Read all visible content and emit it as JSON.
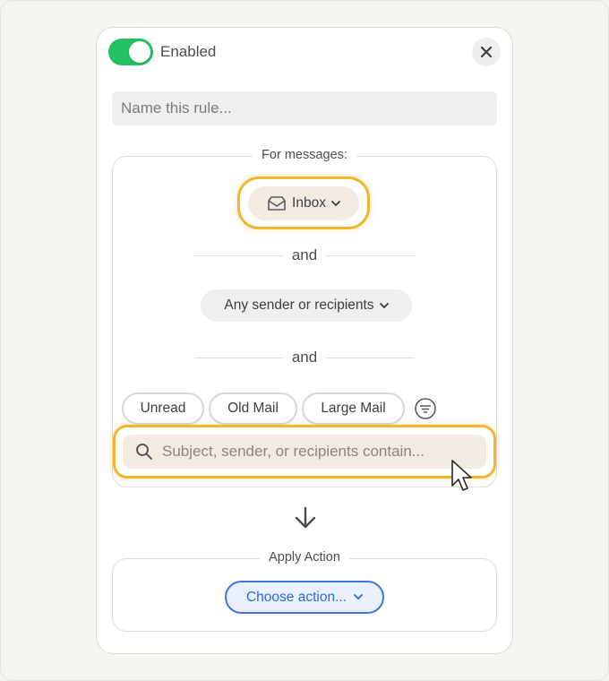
{
  "rule": {
    "enabled_label": "Enabled",
    "enabled": true,
    "name_placeholder": "Name this rule..."
  },
  "conditions": {
    "legend": "For messages:",
    "mailbox_label": "Inbox",
    "conjunction_1": "and",
    "sender_label": "Any sender or recipients",
    "conjunction_2": "and",
    "chips": [
      "Unread",
      "Old Mail",
      "Large Mail"
    ],
    "search_placeholder": "Subject, sender, or recipients contain..."
  },
  "action": {
    "legend": "Apply Action",
    "button_label": "Choose action..."
  },
  "colors": {
    "toggle_on": "#22c263",
    "highlight": "#f3b52b",
    "action_blue": "#3f73e6"
  },
  "icons": [
    "close-icon",
    "envelope-icon",
    "chevron-down-icon",
    "filter-icon",
    "search-icon",
    "arrow-down-icon",
    "pointer-cursor-icon"
  ]
}
